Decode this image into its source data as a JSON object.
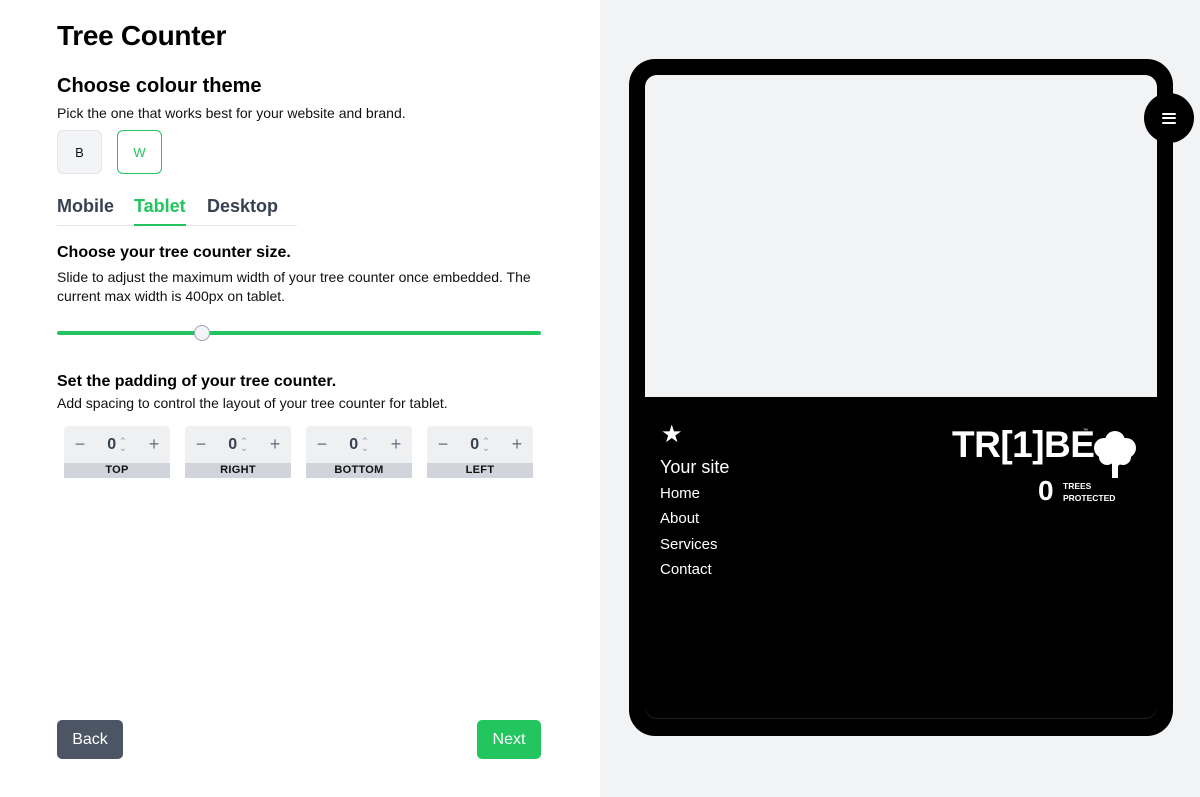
{
  "page": {
    "title": "Tree Counter"
  },
  "theme": {
    "title": "Choose colour theme",
    "description": "Pick the one that works best for your website and brand.",
    "options": [
      {
        "label": "B",
        "selected": false
      },
      {
        "label": "W",
        "selected": true
      }
    ]
  },
  "device_tabs": [
    {
      "label": "Mobile",
      "active": false
    },
    {
      "label": "Tablet",
      "active": true
    },
    {
      "label": "Desktop",
      "active": false
    }
  ],
  "size": {
    "title": "Choose your tree counter size.",
    "description": "Slide to adjust the maximum width of your tree counter once embedded. The current max width is 400px on tablet.",
    "slider_fraction": 0.3
  },
  "padding": {
    "title": "Set the padding of your tree counter.",
    "description": "Add spacing to control the layout of your tree counter for tablet.",
    "decrement_symbol": "−",
    "increment_symbol": "+",
    "fields": [
      {
        "label": "TOP",
        "value": "0"
      },
      {
        "label": "RIGHT",
        "value": "0"
      },
      {
        "label": "BOTTOM",
        "value": "0"
      },
      {
        "label": "LEFT",
        "value": "0"
      }
    ]
  },
  "footer": {
    "back_label": "Back",
    "next_label": "Next"
  },
  "preview": {
    "star_icon": "★",
    "site_name": "Your site",
    "nav_links": [
      "Home",
      "About",
      "Services",
      "Contact"
    ],
    "logo_text": "TR[1]BE",
    "logo_tm": "™",
    "tree_count": "0",
    "tree_label_line1": "TREES",
    "tree_label_line2": "PROTECTED"
  },
  "colors": {
    "accent": "#22c55e",
    "back_button": "#4b5563",
    "preview_bg": "#f2f3f5",
    "device": "#000000"
  }
}
